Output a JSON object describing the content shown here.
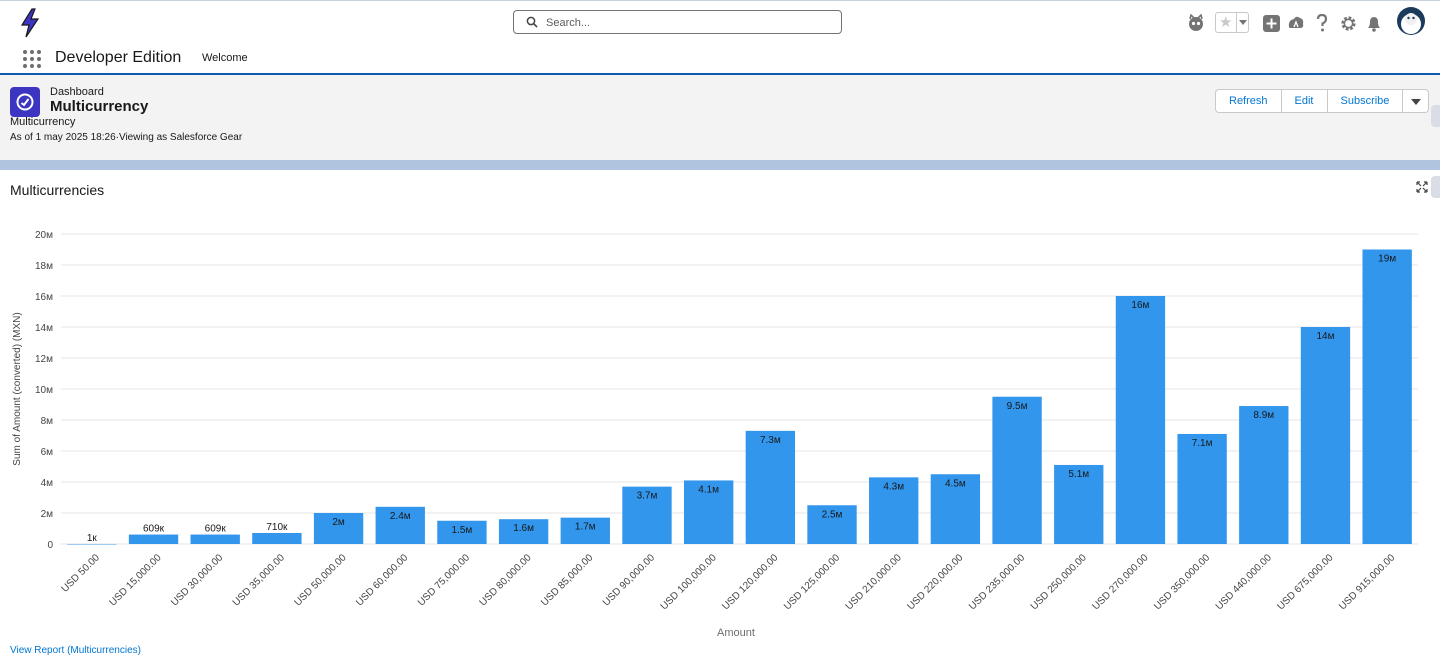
{
  "app": {
    "name": "Developer Edition",
    "nav_tab": "Welcome",
    "search_placeholder": "Search..."
  },
  "header_icons": [
    "einstein-icon",
    "favorites-star-icon",
    "add-icon",
    "trailhead-icon",
    "help-icon",
    "setup-gear-icon",
    "notifications-bell-icon",
    "user-avatar"
  ],
  "dashboard": {
    "type_label": "Dashboard",
    "title": "Multicurrency",
    "subtitle": "Multicurrency",
    "as_of": "As of 1 may 2025 18:26·Viewing as Salesforce Gear",
    "buttons": {
      "refresh": "Refresh",
      "edit": "Edit",
      "subscribe": "Subscribe"
    }
  },
  "component": {
    "title": "Multicurrencies",
    "view_report": "View Report (Multicurrencies)"
  },
  "colors": {
    "bar": "#3296ed",
    "brand": "#0b5cab",
    "link": "#0176d3"
  },
  "chart_data": {
    "type": "bar",
    "xlabel": "Amount",
    "ylabel": "Sum of Amount (converted) (MXN)",
    "ylim": [
      0,
      20000000
    ],
    "yticks": [
      0,
      2000000,
      4000000,
      6000000,
      8000000,
      10000000,
      12000000,
      14000000,
      16000000,
      18000000,
      20000000
    ],
    "ytick_labels": [
      "0",
      "2м",
      "4м",
      "6м",
      "8м",
      "10м",
      "12м",
      "14м",
      "16м",
      "18м",
      "20м"
    ],
    "grid": true,
    "categories": [
      "USD 50.00",
      "USD 15,000.00",
      "USD 30,000.00",
      "USD 35,000.00",
      "USD 50,000.00",
      "USD 60,000.00",
      "USD 75,000.00",
      "USD 80,000.00",
      "USD 85,000.00",
      "USD 90,000.00",
      "USD 100,000.00",
      "USD 120,000.00",
      "USD 125,000.00",
      "USD 210,000.00",
      "USD 220,000.00",
      "USD 235,000.00",
      "USD 250,000.00",
      "USD 270,000.00",
      "USD 350,000.00",
      "USD 440,000.00",
      "USD 675,000.00",
      "USD 915,000.00"
    ],
    "values": [
      1000,
      609000,
      609000,
      710000,
      2000000,
      2400000,
      1500000,
      1600000,
      1700000,
      3700000,
      4100000,
      7300000,
      2500000,
      4300000,
      4500000,
      9500000,
      5100000,
      16000000,
      7100000,
      8900000,
      14000000,
      19000000
    ],
    "data_labels": [
      "1к",
      "609к",
      "609к",
      "710к",
      "2м",
      "2.4м",
      "1.5м",
      "1.6м",
      "1.7м",
      "3.7м",
      "4.1м",
      "7.3м",
      "2.5м",
      "4.3м",
      "4.5м",
      "9.5м",
      "5.1м",
      "16м",
      "7.1м",
      "8.9м",
      "14м",
      "19м"
    ]
  }
}
